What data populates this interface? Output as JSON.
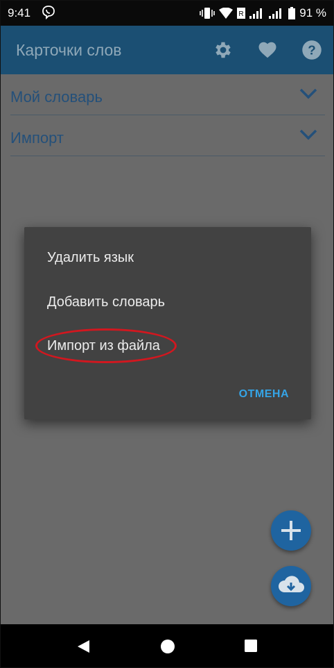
{
  "status_bar": {
    "time": "9:41",
    "battery": "91 %"
  },
  "app_bar": {
    "title": "Карточки слов",
    "icons": [
      "settings-icon",
      "heart-icon",
      "help-icon"
    ]
  },
  "list": {
    "items": [
      {
        "label": "Мой словарь"
      },
      {
        "label": "Импорт"
      }
    ]
  },
  "dialog": {
    "items": [
      {
        "label": "Удалить язык"
      },
      {
        "label": "Добавить словарь"
      },
      {
        "label": "Импорт из файла"
      }
    ],
    "cancel": "ОТМЕНА"
  },
  "fabs": [
    "add-icon",
    "cloud-download-icon"
  ],
  "colors": {
    "app_bar": "#1b4f73",
    "accent": "#35a4e6",
    "dialog_bg": "#424242",
    "highlight": "#d2171f"
  }
}
